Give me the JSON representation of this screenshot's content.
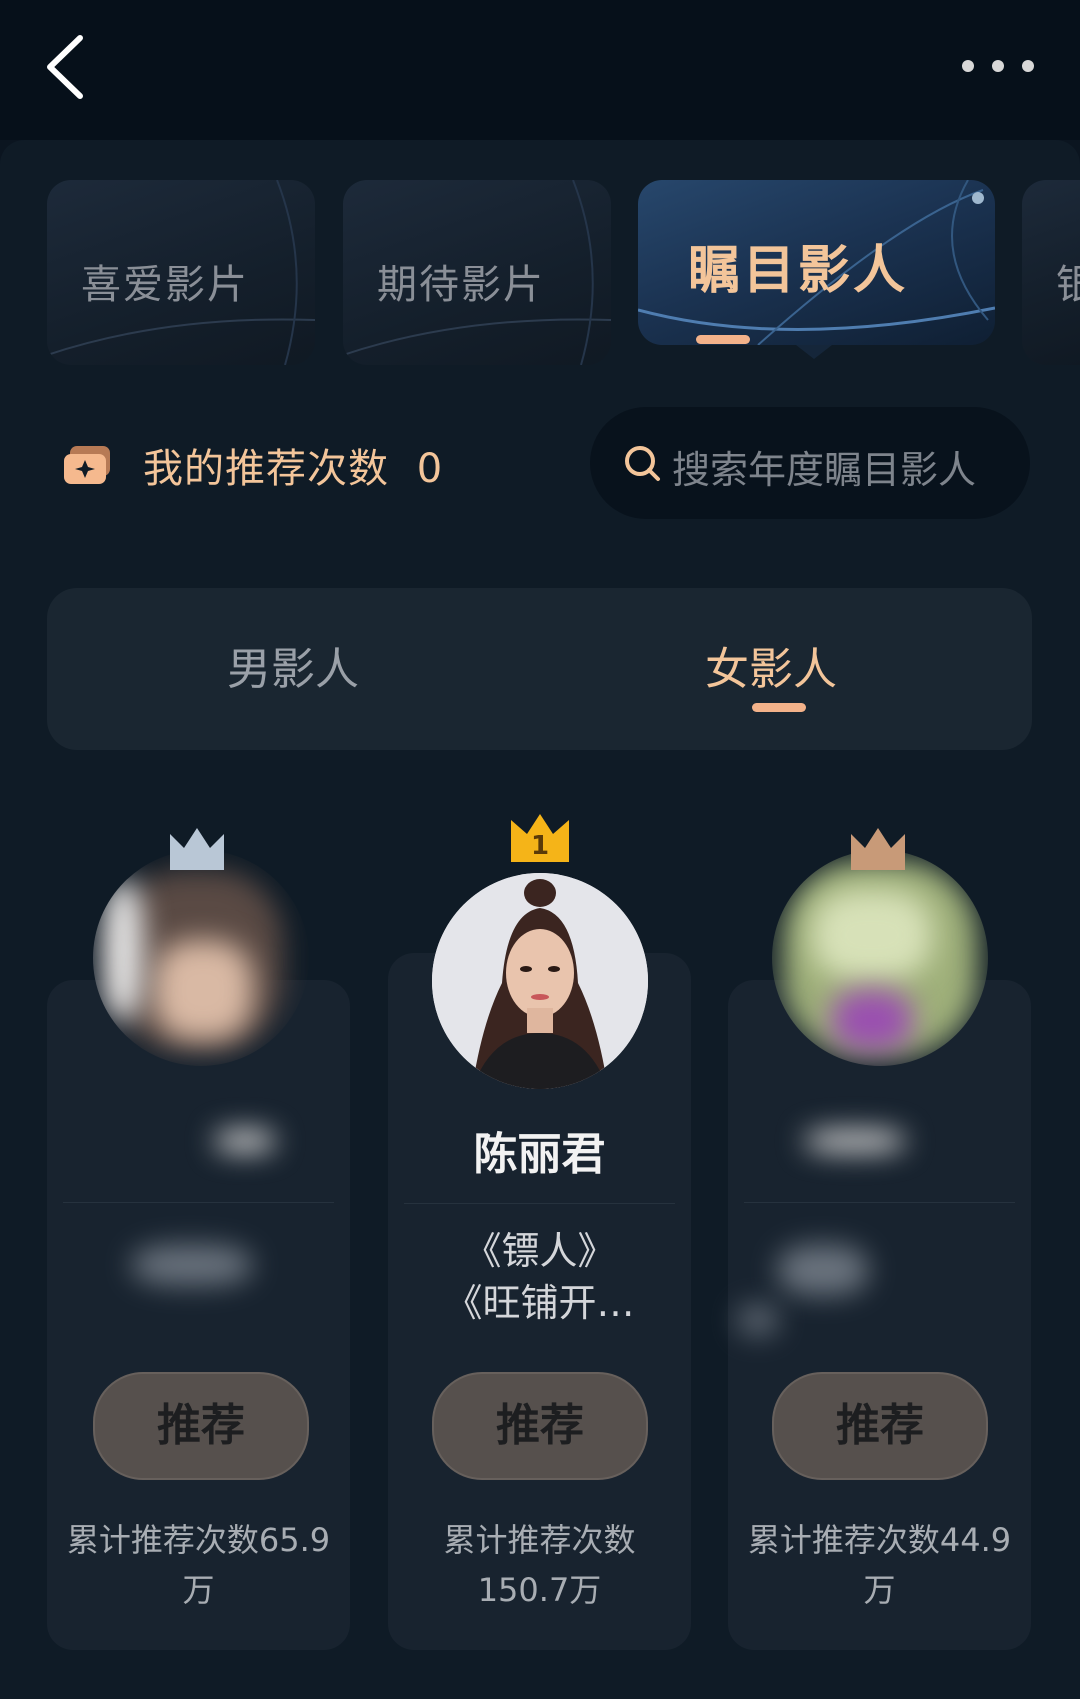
{
  "categories": [
    {
      "label": "喜爱影片",
      "active": false
    },
    {
      "label": "期待影片",
      "active": false
    },
    {
      "label": "瞩目影人",
      "active": true
    },
    {
      "label": "银",
      "active": false
    }
  ],
  "recommend": {
    "label": "我的推荐次数",
    "count": "0"
  },
  "search": {
    "placeholder": "搜索年度瞩目影人"
  },
  "gender_tabs": [
    {
      "label": "男影人",
      "active": false
    },
    {
      "label": "女影人",
      "active": true
    }
  ],
  "ranking": {
    "first": {
      "rank": "1",
      "name": "陈丽君",
      "work1": "《镖人》",
      "work2": "《旺铺开…",
      "button": "推荐",
      "total_line1": "累计推荐次数",
      "total_line2": "150.7万"
    },
    "second": {
      "rank": "2",
      "button": "推荐",
      "total_line1": "累计推荐次数65.9",
      "total_line2": "万"
    },
    "third": {
      "rank": "3",
      "button": "推荐",
      "total_line1": "累计推荐次数44.9",
      "total_line2": "万"
    }
  },
  "colors": {
    "accent": "#f3c59a",
    "background": "#0b1520",
    "card": "#18232f",
    "button": "#56504d",
    "crown_gold": "#f5b418"
  }
}
